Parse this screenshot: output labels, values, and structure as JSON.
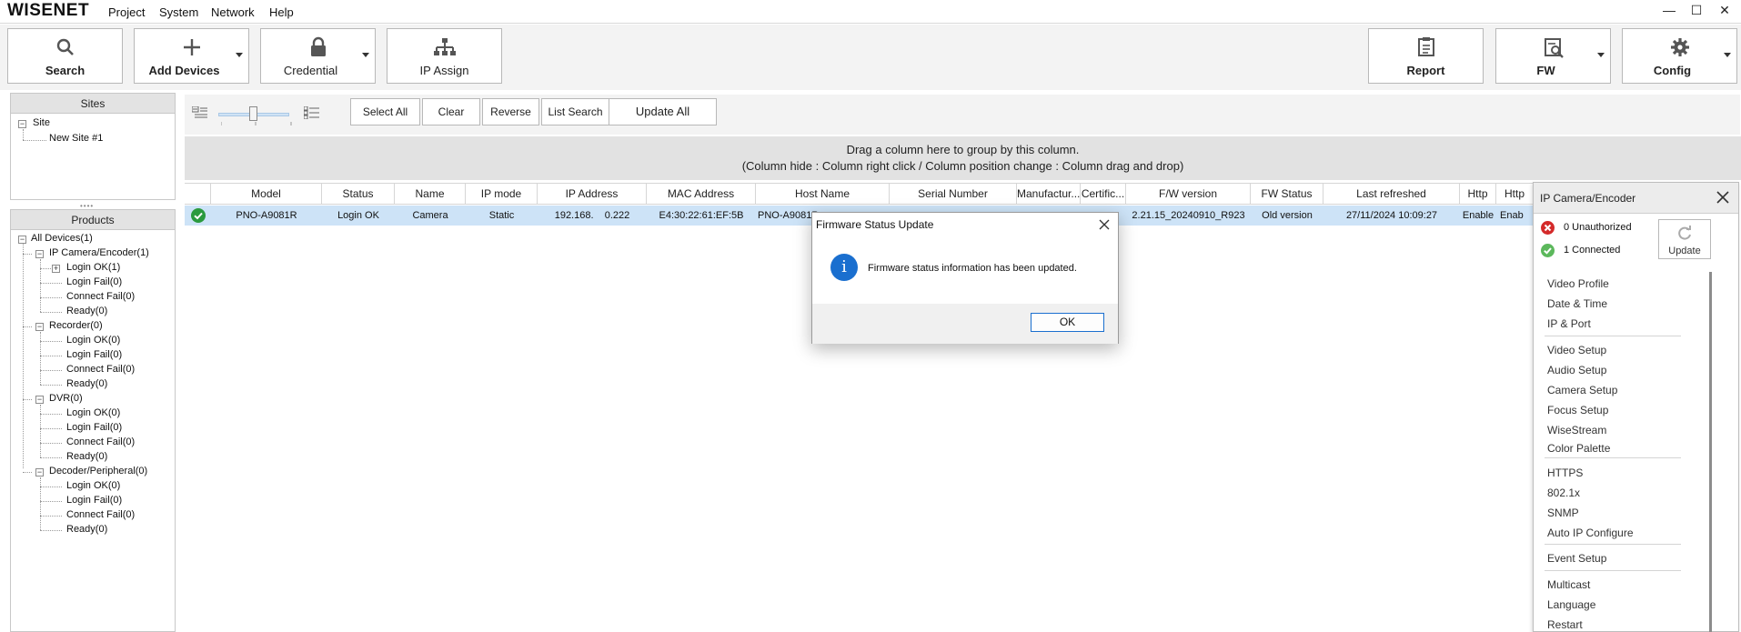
{
  "app": {
    "logo": "WISENET",
    "menu": [
      "Project",
      "System",
      "Network",
      "Help"
    ],
    "window_controls": [
      "—",
      "☐",
      "✕"
    ]
  },
  "toolbar": {
    "search": "Search",
    "add_devices": "Add Devices",
    "credential": "Credential",
    "ip_assign": "IP Assign",
    "report": "Report",
    "fw": "FW",
    "config": "Config"
  },
  "sites": {
    "header": "Sites",
    "root": "Site",
    "child": "New Site #1"
  },
  "products": {
    "header": "Products",
    "all": "All Devices(1)",
    "groups": [
      {
        "label": "IP Camera/Encoder(1)",
        "items": [
          "Login OK(1)",
          "Login Fail(0)",
          "Connect Fail(0)",
          "Ready(0)"
        ]
      },
      {
        "label": "Recorder(0)",
        "items": [
          "Login OK(0)",
          "Login Fail(0)",
          "Connect Fail(0)",
          "Ready(0)"
        ]
      },
      {
        "label": "DVR(0)",
        "items": [
          "Login OK(0)",
          "Login Fail(0)",
          "Connect Fail(0)",
          "Ready(0)"
        ]
      },
      {
        "label": "Decoder/Peripheral(0)",
        "items": [
          "Login OK(0)",
          "Login Fail(0)",
          "Connect Fail(0)",
          "Ready(0)"
        ]
      }
    ]
  },
  "filterbar": {
    "select_all": "Select All",
    "clear": "Clear",
    "reverse": "Reverse",
    "list_search": "List Search",
    "update_all": "Update All"
  },
  "groupband": {
    "line1": "Drag a column here to group by this column.",
    "line2": "(Column hide : Column right click / Column position change : Column drag and drop)"
  },
  "grid": {
    "columns": [
      "Model",
      "Status",
      "Name",
      "IP mode",
      "IP Address",
      "MAC Address",
      "Host Name",
      "Serial Number",
      "Manufactur...",
      "Certific...",
      "F/W version",
      "FW Status",
      "Last refreshed",
      "Http",
      "Http"
    ],
    "row": {
      "model": "PNO-A9081R",
      "status": "Login OK",
      "name": "Camera",
      "ip_mode": "Static",
      "ip_address": "192.168.    0.222",
      "mac": "E4:30:22:61:EF:5B",
      "host": "PNO-A9081R",
      "fw_version": "2.21.15_20240910_R923",
      "fw_status": "Old version",
      "last_refreshed": "27/11/2024 10:09:27",
      "http": "Enable",
      "http2": "Enab"
    }
  },
  "right_panel": {
    "title": "IP Camera/Encoder",
    "unauthorized": "0 Unauthorized",
    "connected": "1 Connected",
    "update": "Update",
    "items": [
      "Video Profile",
      "Date & Time",
      "IP & Port",
      "Video Setup",
      "Audio Setup",
      "Camera Setup",
      "Focus Setup",
      "WiseStream",
      "Color Palette",
      "HTTPS",
      "802.1x",
      "SNMP",
      "Auto IP Configure",
      "Event Setup",
      "Multicast",
      "Language",
      "Restart"
    ]
  },
  "dialog": {
    "title": "Firmware Status Update",
    "message": "Firmware status information has been updated.",
    "ok": "OK"
  },
  "colors": {
    "selected_row": "#cde3f7",
    "ok_green": "#2a9a3e",
    "error_red": "#d42a2a",
    "info_blue": "#1a6fcf"
  }
}
